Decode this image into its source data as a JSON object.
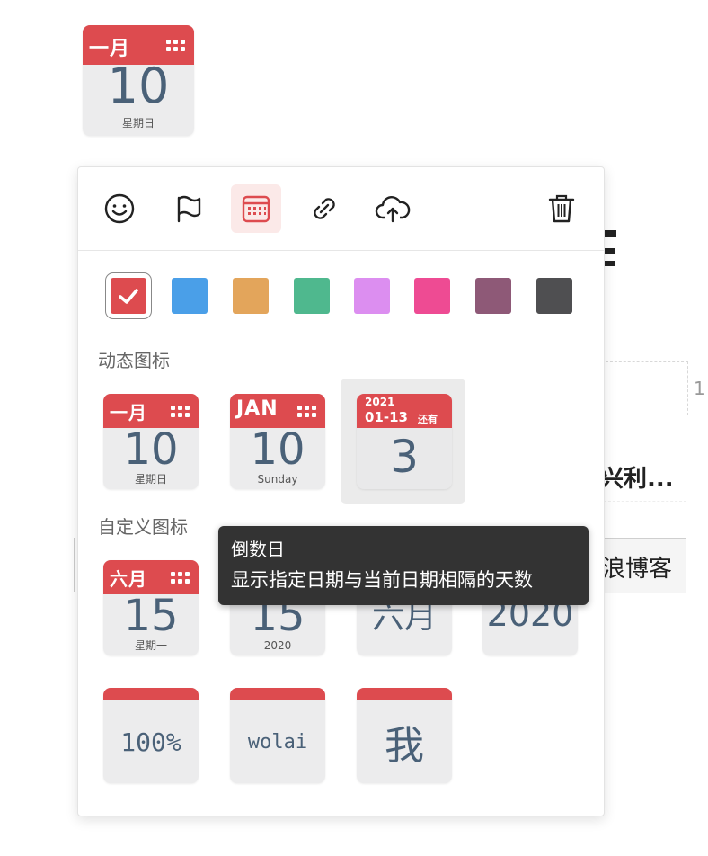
{
  "page_icon": {
    "month": "一月",
    "day": "10",
    "weekday": "星期日"
  },
  "background": {
    "frag_right": "兴利...",
    "frag_blog": "浪博客",
    "frag_num": "1"
  },
  "toolbar": {
    "buttons": [
      {
        "icon": "smile-icon"
      },
      {
        "icon": "flag-icon"
      },
      {
        "icon": "calendar-icon",
        "active": true
      },
      {
        "icon": "link-icon"
      },
      {
        "icon": "cloud-upload-icon"
      },
      {
        "icon": "trash-icon"
      }
    ]
  },
  "colors": [
    "#dd4b4f",
    "#4a9fe8",
    "#e3a55b",
    "#4fb88e",
    "#dc8ef0",
    "#ee4b93",
    "#8e5977",
    "#4f4f51"
  ],
  "sections": {
    "dynamic": "动态图标",
    "custom": "自定义图标"
  },
  "dynamic_icons": [
    {
      "month": "一月",
      "day": "10",
      "weekday": "星期日"
    },
    {
      "month": "JAN",
      "day": "10",
      "weekday": "Sunday"
    },
    {
      "year": "2021",
      "date": "01-13",
      "tag": "还有",
      "count": "3"
    }
  ],
  "custom_icons": [
    {
      "month": "六月",
      "day": "15",
      "weekday": "星期一"
    },
    {
      "day": "15",
      "weekday": "2020"
    },
    {
      "text": "六月"
    },
    {
      "text": "2020"
    },
    {
      "text": "100%"
    },
    {
      "text": "wolai"
    },
    {
      "text": "我"
    }
  ],
  "tooltip": {
    "title": "倒数日",
    "description": "显示指定日期与当前日期相隔的天数"
  }
}
